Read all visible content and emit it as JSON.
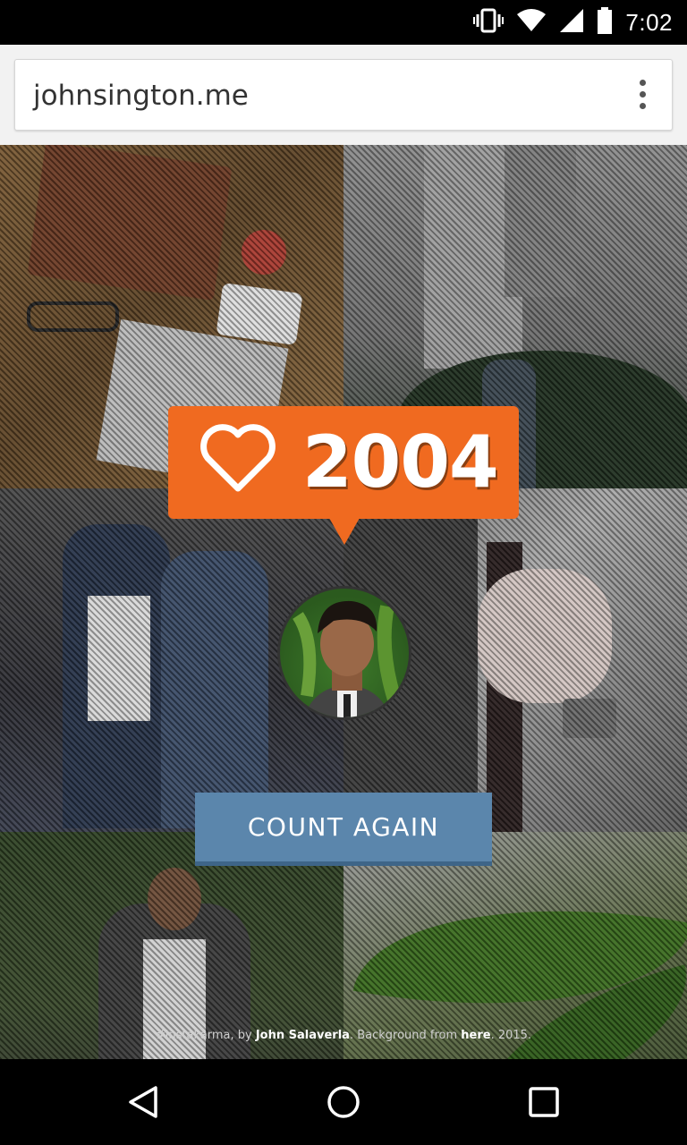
{
  "status_bar": {
    "time": "7:02",
    "icons": [
      "vibrate-icon",
      "wifi-icon",
      "signal-icon",
      "battery-icon"
    ]
  },
  "browser": {
    "url": "johnsington.me",
    "menu_icon": "more-vert-icon"
  },
  "counter": {
    "icon": "heart-outline-icon",
    "value": "2004",
    "color": "#f06a20"
  },
  "button": {
    "label": "COUNT AGAIN",
    "color": "#5b86ac"
  },
  "footer": {
    "prefix": "#instakarma, by ",
    "author": "John Salaverla",
    "middle": ". Background from ",
    "link": "here",
    "suffix": ". 2015."
  },
  "nav_bar": {
    "icons": [
      "back-icon",
      "home-icon",
      "recents-icon"
    ]
  }
}
